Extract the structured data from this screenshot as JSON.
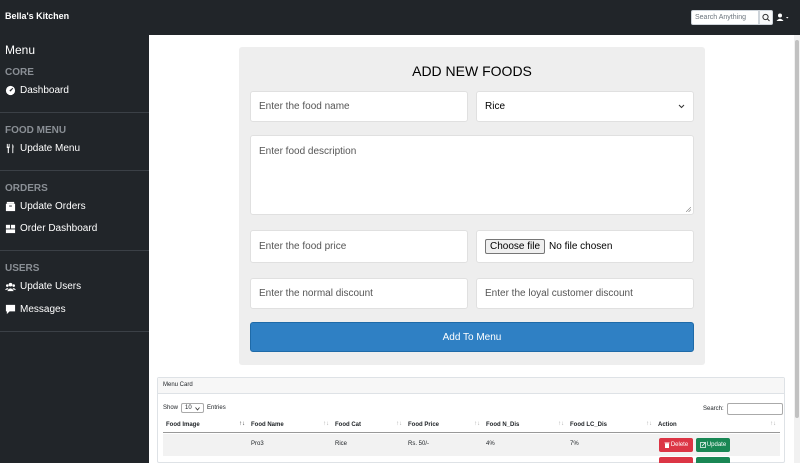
{
  "header": {
    "brand": "Bella's Kitchen",
    "search_placeholder": "Search Anything"
  },
  "sidebar": {
    "title": "Menu",
    "sections": [
      {
        "heading": "CORE",
        "items": [
          {
            "label": "Dashboard",
            "icon": "dashboard-icon"
          }
        ]
      },
      {
        "heading": "FOOD MENU",
        "items": [
          {
            "label": "Update Menu",
            "icon": "utensils-icon"
          }
        ]
      },
      {
        "heading": "ORDERS",
        "items": [
          {
            "label": "Update Orders",
            "icon": "box-icon"
          },
          {
            "label": "Order Dashboard",
            "icon": "boxes-icon"
          }
        ]
      },
      {
        "heading": "USERS",
        "items": [
          {
            "label": "Update Users",
            "icon": "users-icon"
          },
          {
            "label": "Messages",
            "icon": "message-icon"
          }
        ]
      }
    ]
  },
  "form": {
    "title": "ADD NEW FOODS",
    "name_placeholder": "Enter the food name",
    "category_value": "Rice",
    "description_placeholder": "Enter food description",
    "price_placeholder": "Enter the food price",
    "file_button": "Choose file",
    "file_status": "No file chosen",
    "normal_discount_placeholder": "Enter the normal discount",
    "loyal_discount_placeholder": "Enter the loyal customer discount",
    "submit_label": "Add To Menu"
  },
  "menu_card": {
    "header": "Menu Card",
    "show_label": "Show",
    "entries_value": "10",
    "entries_label": "Entries",
    "search_label": "Search:",
    "columns": [
      "Food Image",
      "Food Name",
      "Food Cat",
      "Food Price",
      "Food N_Dis",
      "Food LC_Dis",
      "Action"
    ],
    "rows": [
      {
        "image": "",
        "name": "Pro3",
        "category": "Rice",
        "price": "Rs. 50/-",
        "normal_discount": "4%",
        "loyal_discount": "7%"
      }
    ],
    "delete_label": "Delete",
    "update_label": "Update"
  },
  "colors": {
    "dark": "#212529",
    "primary": "#2f80c4",
    "danger": "#dc3545",
    "success": "#198754"
  }
}
